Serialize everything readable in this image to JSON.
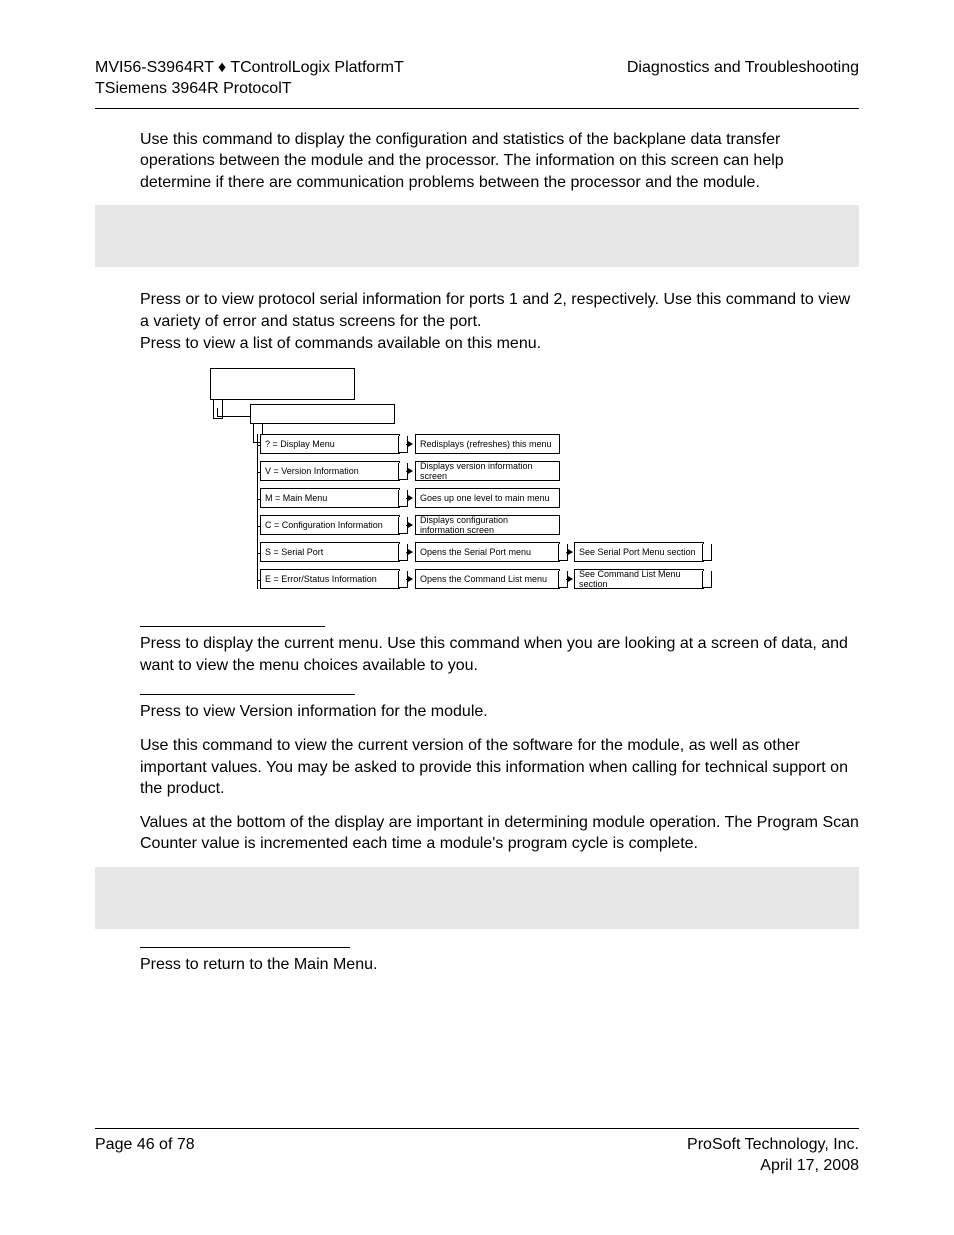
{
  "header": {
    "left1": "MVI56-S3964RT ♦ TControlLogix PlatformT",
    "left2": "TSiemens 3964R ProtocolT",
    "right": "Diagnostics and Troubleshooting"
  },
  "para1": "Use this command to display the configuration and statistics of the backplane data transfer operations between the module and the processor. The information on this screen can help determine if there are communication problems between the processor and the module.",
  "para2a": "Press       or       to view protocol serial information for ports 1 and 2, respectively. Use this command to view a variety of error and status screens for the port.",
  "para2b": "Press       to view a list of commands available on this menu.",
  "diagram": {
    "rows": [
      {
        "left": "? = Display Menu",
        "mid": "Redisplays (refreshes) this menu",
        "right": ""
      },
      {
        "left": "V = Version Information",
        "mid": "Displays version information screen",
        "right": ""
      },
      {
        "left": "M = Main Menu",
        "mid": "Goes up one level to main menu",
        "right": ""
      },
      {
        "left": "C = Configuration Information",
        "mid": "Displays configuration information screen",
        "right": ""
      },
      {
        "left": "S = Serial Port",
        "mid": "Opens the Serial Port menu",
        "right": "See Serial Port Menu section"
      },
      {
        "left": "E = Error/Status Information",
        "mid": "Opens the Command List menu",
        "right": "See Command List Menu section"
      }
    ]
  },
  "para3": "Press       to display the current menu. Use this command when you are looking at a screen of data, and want to view the menu choices available to you.",
  "para4": "Press       to view Version information for the module.",
  "para5": "Use this command to view the current version of the software for the module, as well as other important values. You may be asked to provide this information when calling for technical support on the product.",
  "para6": "Values at the bottom of the display are important in determining module operation. The Program Scan Counter value is incremented each time a module's program cycle is complete.",
  "para7": "Press       to return to the Main Menu.",
  "footer": {
    "left": "Page 46 of 78",
    "right1": "ProSoft Technology, Inc.",
    "right2": "April 17, 2008"
  }
}
